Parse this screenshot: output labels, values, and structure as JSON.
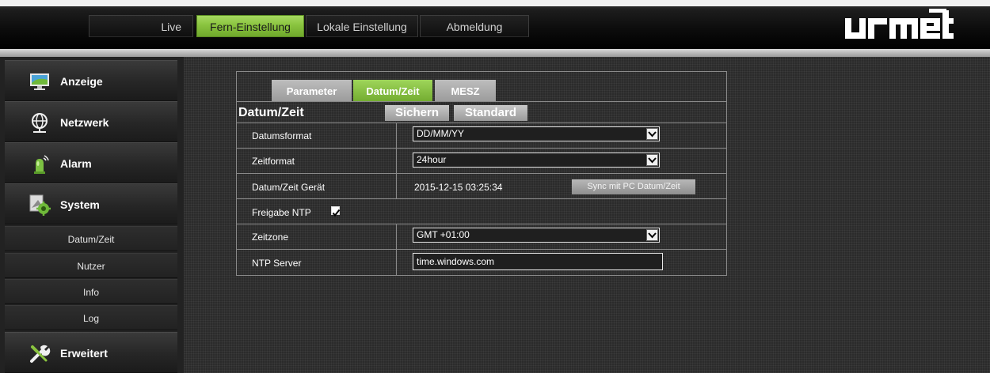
{
  "header": {
    "nav": [
      "Live",
      "Fern-Einstellung",
      "Lokale Einstellung",
      "Abmeldung"
    ],
    "active_nav": "Fern-Einstellung",
    "logo": "urmet"
  },
  "sidebar": {
    "menu": [
      {
        "label": "Anzeige",
        "icon": "monitor-icon"
      },
      {
        "label": "Netzwerk",
        "icon": "network-globe-icon"
      },
      {
        "label": "Alarm",
        "icon": "alarm-siren-icon"
      },
      {
        "label": "System",
        "icon": "system-gear-icon"
      },
      {
        "label": "Erweitert",
        "icon": "tools-icon"
      }
    ],
    "submenu": [
      "Datum/Zeit",
      "Nutzer",
      "Info",
      "Log"
    ]
  },
  "panel": {
    "tabs": [
      "Parameter",
      "Datum/Zeit",
      "MESZ"
    ],
    "active_tab": "Datum/Zeit",
    "title": "Datum/Zeit",
    "save_label": "Sichern",
    "default_label": "Standard",
    "rows": {
      "date_format": {
        "label": "Datumsformat",
        "value": "DD/MM/YY"
      },
      "time_format": {
        "label": "Zeitformat",
        "value": "24hour"
      },
      "device_time": {
        "label": "Datum/Zeit Gerät",
        "value": "2015-12-15 03:25:34",
        "button": "Sync mit PC Datum/Zeit"
      },
      "ntp_enable": {
        "label": "Freigabe NTP",
        "checked": true
      },
      "timezone": {
        "label": "Zeitzone",
        "value": "GMT +01:00"
      },
      "ntp_server": {
        "label": "NTP Server",
        "value": "time.windows.com"
      }
    }
  },
  "colors": {
    "accent_green": "#8ac43f",
    "panel_bg": "#2b2b2b",
    "header_bg": "#0c0c0c"
  }
}
